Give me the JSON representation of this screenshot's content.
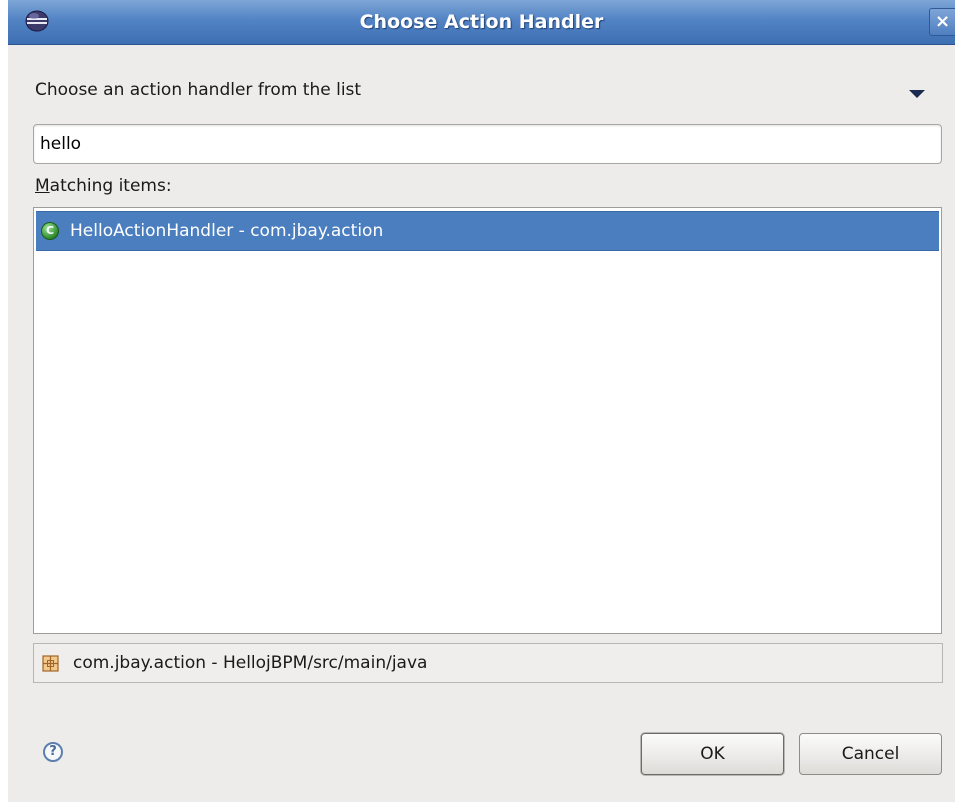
{
  "window": {
    "title": "Choose Action Handler",
    "close_glyph": "×"
  },
  "dialog": {
    "prompt": "Choose an action handler from the list",
    "search": {
      "value": "hello",
      "placeholder": ""
    },
    "matching_label": {
      "mnemonic": "M",
      "rest": "atching items:"
    },
    "results": [
      {
        "icon": "java-class-icon",
        "label": "HelloActionHandler - com.jbay.action",
        "selected": true
      }
    ],
    "details": {
      "icon": "package-icon",
      "label": "com.jbay.action - HellojBPM/src/main/java"
    }
  },
  "footer": {
    "help_glyph": "?",
    "ok_label": "OK",
    "cancel_label": "Cancel"
  },
  "colors": {
    "titlebar": "#5283c4",
    "selection": "#4a7ebf",
    "background": "#edeceb"
  }
}
